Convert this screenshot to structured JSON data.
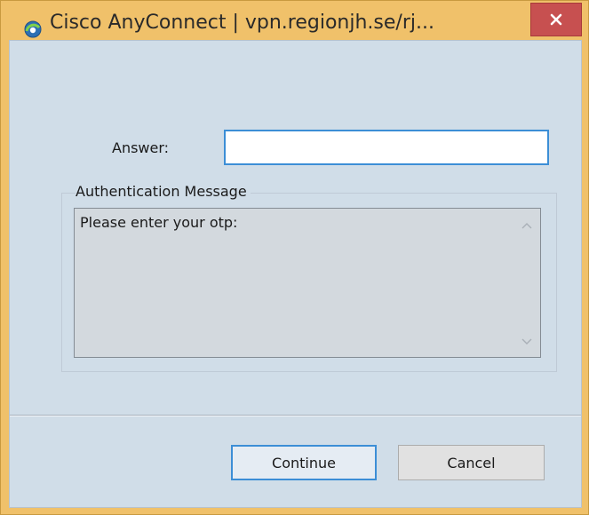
{
  "window": {
    "title": "Cisco AnyConnect | vpn.regionjh.se/rj...",
    "close_icon": "close-icon",
    "app_icon": "cisco-anyconnect-icon"
  },
  "form": {
    "answer_label": "Answer:",
    "answer_value": "",
    "auth_group_label": "Authentication Message",
    "auth_message": "Please enter your otp:"
  },
  "buttons": {
    "continue_label": "Continue",
    "cancel_label": "Cancel"
  },
  "colors": {
    "title_bar": "#f0c16a",
    "close_button": "#c75050",
    "client_bg": "#d0dde8",
    "focus_accent": "#3c8ed6"
  }
}
